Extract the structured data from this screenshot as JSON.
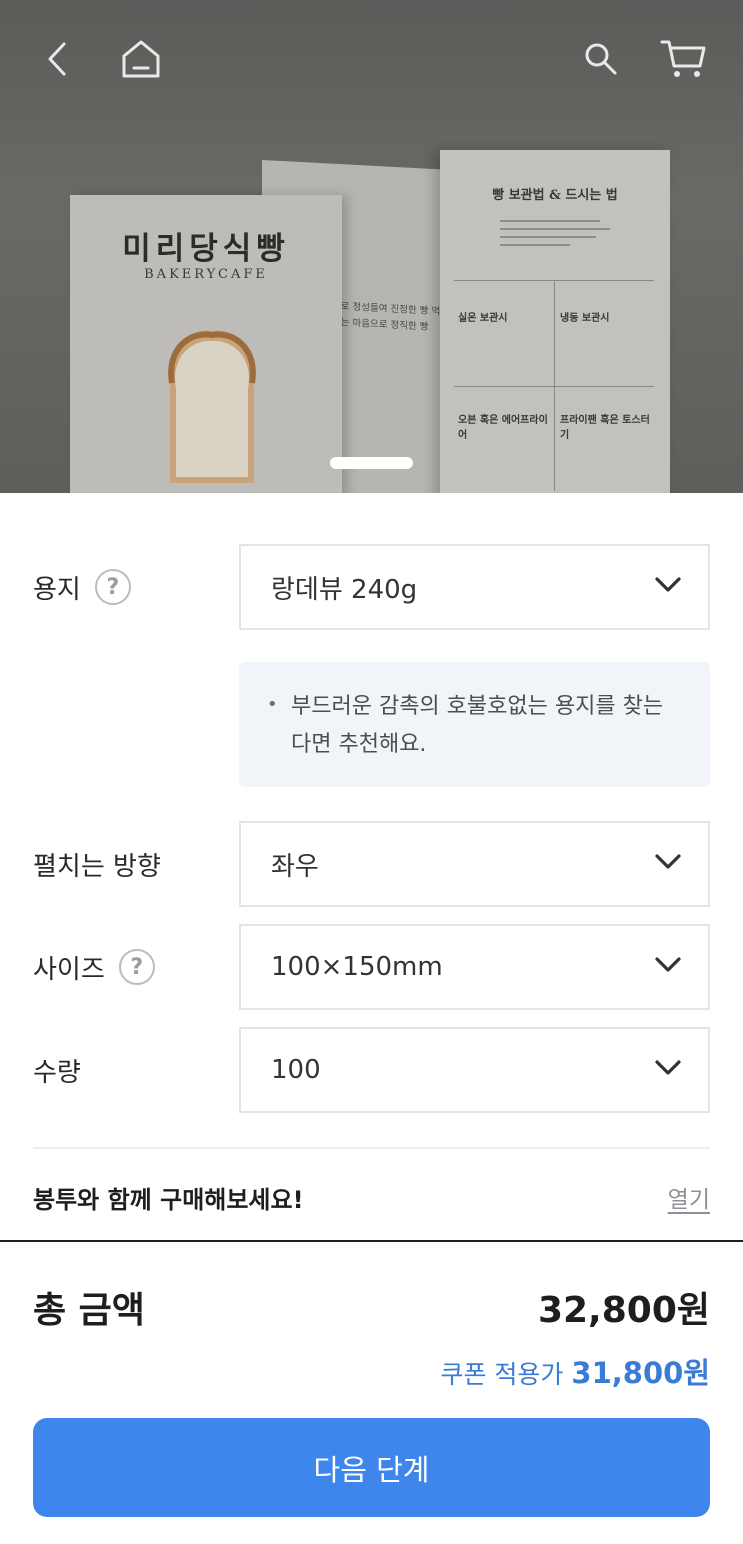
{
  "hero": {
    "cover_title": "미리당식빵",
    "cover_subtitle": "BAKERYCAFE",
    "middle_text": "토로 정성들여 진정한 빵 먹는다는 마음으로 정직한 빵",
    "right_title": "빵 보관법 & 드시는 법",
    "panels": [
      "실온 보관시",
      "냉동 보관시",
      "오븐 혹은 에어프라이어",
      "프라이팬 혹은 토스터기"
    ]
  },
  "options": {
    "paper_label": "용지",
    "paper_value": "랑데뷰 240g",
    "paper_info": "부드러운 감촉의 호불호없는 용지를 찾는다면 추천해요.",
    "fold_label": "펼치는 방향",
    "fold_value": "좌우",
    "size_label": "사이즈",
    "size_value": "100×150mm",
    "qty_label": "수량",
    "qty_value": "100",
    "help_glyph": "?"
  },
  "envelope": {
    "title": "봉투와 함께 구매해보세요!",
    "open_label": "열기"
  },
  "summary": {
    "total_label": "총 금액",
    "total_price": "32,800원",
    "coupon_label": "쿠폰 적용가",
    "coupon_price": "31,800원"
  },
  "cta": {
    "next_label": "다음 단계"
  },
  "colors": {
    "accent": "#3f86ec",
    "coupon_blue": "#3a7bd5",
    "info_bg": "#f1f4f8"
  }
}
